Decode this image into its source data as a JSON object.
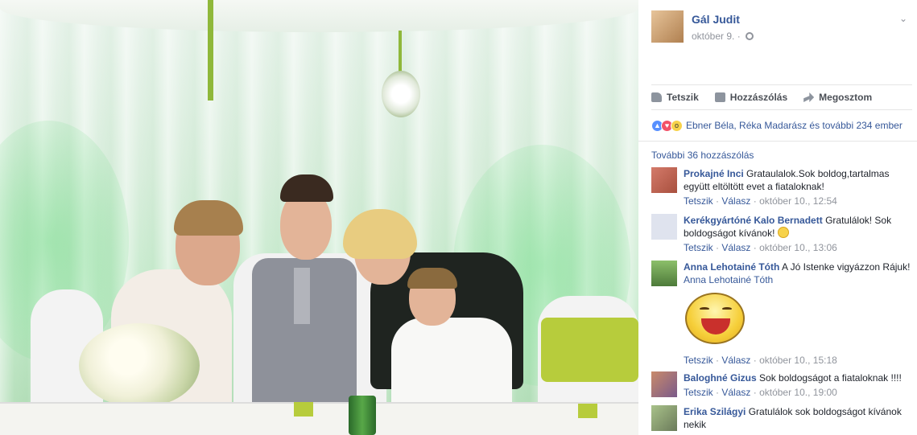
{
  "post": {
    "author": "Gál Judit",
    "date": "október 9. ·",
    "icons": {
      "privacy": "globe-icon",
      "menu": "chevron-down-icon"
    }
  },
  "actions": [
    {
      "label": "Tetszik",
      "icon": "thumbs-up-icon"
    },
    {
      "label": "Hozzászólás",
      "icon": "comment-icon"
    },
    {
      "label": "Megosztom",
      "icon": "share-icon"
    }
  ],
  "reactions": {
    "text": "Ebner Béla, Réka Madarász és további 234 ember",
    "icons": [
      "like-icon",
      "love-icon",
      "wow-icon"
    ]
  },
  "comments_more": "További 36 hozzászólás",
  "comments": [
    {
      "name": "Prokajné Inci",
      "text": "Grataulalok.Sok boldog,tartalmas együtt eltöltött evet a fiataloknak!",
      "like": "Tetszik",
      "reply": "Válasz",
      "time": "október 10., 12:54"
    },
    {
      "name": "Kerékgyártóné Kalo Bernadett",
      "text": "Gratulálok! Sok boldogságot kívánok!",
      "like": "Tetszik",
      "reply": "Válasz",
      "time": "október 10., 13:06"
    },
    {
      "name": "Anna Lehotainé Tóth",
      "text": "A Jó Istenke vigyázzon Rájuk!",
      "tag": "Anna Lehotainé Tóth",
      "like": "Tetszik",
      "reply": "Válasz",
      "time": "október 10., 15:18"
    },
    {
      "name": "Baloghné Gizus",
      "text": "Sok boldogságot a fiataloknak !!!!",
      "like": "Tetszik",
      "reply": "Válasz",
      "time": "október 10., 19:00"
    },
    {
      "name": "Erika Szilágyi",
      "text": "Gratulálok sok boldogságot kívánok nekik"
    }
  ],
  "colors": {
    "link": "#365899",
    "meta": "#90949c",
    "accent_green": "#b7cc3c"
  }
}
